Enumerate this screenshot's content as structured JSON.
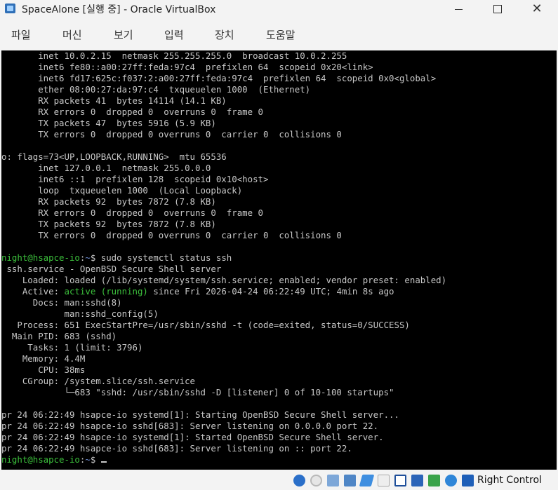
{
  "window": {
    "title": "SpaceAlone [실행 중] - Oracle VirtualBox"
  },
  "menu": [
    "파일",
    "머신",
    "보기",
    "입력",
    "장치",
    "도움말"
  ],
  "terminal": {
    "lines": [
      [
        {
          "t": "       inet 10.0.2.15  netmask 255.255.255.0  broadcast 10.0.2.255"
        }
      ],
      [
        {
          "t": "       inet6 fe80::a00:27ff:feda:97c4  prefixlen 64  scopeid 0x20<link>"
        }
      ],
      [
        {
          "t": "       inet6 fd17:625c:f037:2:a00:27ff:feda:97c4  prefixlen 64  scopeid 0x0<global>"
        }
      ],
      [
        {
          "t": "       ether 08:00:27:da:97:c4  txqueuelen 1000  (Ethernet)"
        }
      ],
      [
        {
          "t": "       RX packets 41  bytes 14114 (14.1 KB)"
        }
      ],
      [
        {
          "t": "       RX errors 0  dropped 0  overruns 0  frame 0"
        }
      ],
      [
        {
          "t": "       TX packets 47  bytes 5916 (5.9 KB)"
        }
      ],
      [
        {
          "t": "       TX errors 0  dropped 0 overruns 0  carrier 0  collisions 0"
        }
      ],
      [
        {
          "t": ""
        }
      ],
      [
        {
          "t": "o: flags=73<UP,LOOPBACK,RUNNING>  mtu 65536"
        }
      ],
      [
        {
          "t": "       inet 127.0.0.1  netmask 255.0.0.0"
        }
      ],
      [
        {
          "t": "       inet6 ::1  prefixlen 128  scopeid 0x10<host>"
        }
      ],
      [
        {
          "t": "       loop  txqueuelen 1000  (Local Loopback)"
        }
      ],
      [
        {
          "t": "       RX packets 92  bytes 7872 (7.8 KB)"
        }
      ],
      [
        {
          "t": "       RX errors 0  dropped 0  overruns 0  frame 0"
        }
      ],
      [
        {
          "t": "       TX packets 92  bytes 7872 (7.8 KB)"
        }
      ],
      [
        {
          "t": "       TX errors 0  dropped 0 overruns 0  carrier 0  collisions 0"
        }
      ],
      [
        {
          "t": ""
        }
      ],
      [
        {
          "t": "night@hsapce-io",
          "c": "g"
        },
        {
          "t": ":"
        },
        {
          "t": "~",
          "c": "b"
        },
        {
          "t": "$ sudo systemctl status ssh"
        }
      ],
      [
        {
          "t": " ssh.service - OpenBSD Secure Shell server"
        }
      ],
      [
        {
          "t": "    Loaded: loaded (/lib/systemd/system/ssh.service; enabled; vendor preset: enabled)"
        }
      ],
      [
        {
          "t": "    Active: "
        },
        {
          "t": "active (running)",
          "c": "g"
        },
        {
          "t": " since Fri 2026-04-24 06:22:49 UTC; 4min 8s ago"
        }
      ],
      [
        {
          "t": "      Docs: man:sshd(8)"
        }
      ],
      [
        {
          "t": "            man:sshd_config(5)"
        }
      ],
      [
        {
          "t": "   Process: 651 ExecStartPre=/usr/sbin/sshd -t (code=exited, status=0/SUCCESS)"
        }
      ],
      [
        {
          "t": "  Main PID: 683 (sshd)"
        }
      ],
      [
        {
          "t": "     Tasks: 1 (limit: 3796)"
        }
      ],
      [
        {
          "t": "    Memory: 4.4M"
        }
      ],
      [
        {
          "t": "       CPU: 38ms"
        }
      ],
      [
        {
          "t": "    CGroup: /system.slice/ssh.service"
        }
      ],
      [
        {
          "t": "            └─683 \"sshd: /usr/sbin/sshd -D [listener] 0 of 10-100 startups\""
        }
      ],
      [
        {
          "t": ""
        }
      ],
      [
        {
          "t": "pr 24 06:22:49 hsapce-io systemd[1]: Starting OpenBSD Secure Shell server..."
        }
      ],
      [
        {
          "t": "pr 24 06:22:49 hsapce-io sshd[683]: Server listening on 0.0.0.0 port 22."
        }
      ],
      [
        {
          "t": "pr 24 06:22:49 hsapce-io systemd[1]: Started OpenBSD Secure Shell server."
        }
      ],
      [
        {
          "t": "pr 24 06:22:49 hsapce-io sshd[683]: Server listening on :: port 22."
        }
      ],
      [
        {
          "t": "night@hsapce-io",
          "c": "g"
        },
        {
          "t": ":"
        },
        {
          "t": "~",
          "c": "b"
        },
        {
          "t": "$ "
        },
        {
          "cursor": true
        }
      ]
    ]
  },
  "statusbar": {
    "host_key": "Right Control",
    "icons": [
      "hard-disk-icon",
      "optical-drive-icon",
      "audio-icon",
      "network-icon",
      "usb-icon",
      "shared-folder-icon",
      "display-icon",
      "recording-icon",
      "cpu-icon",
      "mouse-integration-icon",
      "keyboard-icon"
    ]
  },
  "colors": {
    "prompt_green": "#3cc13c",
    "prompt_blue": "#6e8fd6",
    "terminal_bg": "#000000",
    "terminal_fg": "#c8c8c8"
  }
}
